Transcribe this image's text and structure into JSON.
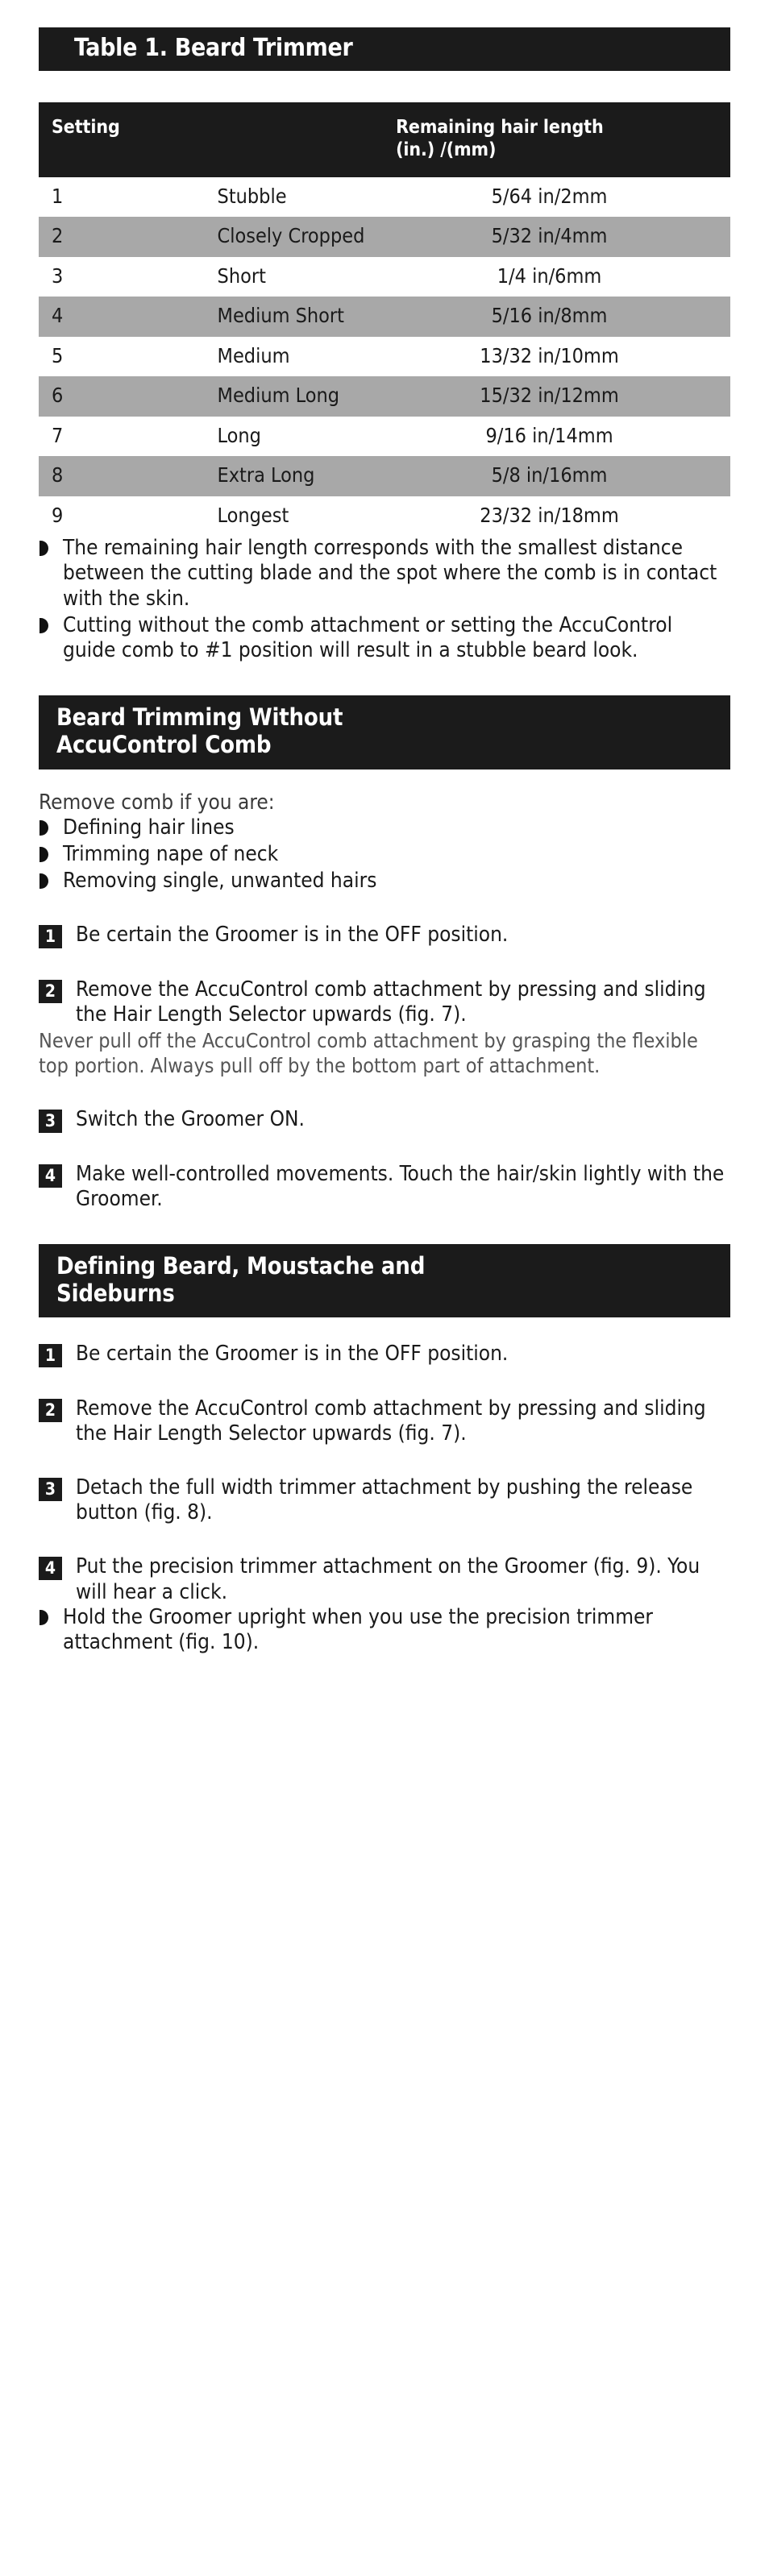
{
  "table_section": {
    "title": "Table 1. Beard Trimmer",
    "columns": [
      "Setting",
      "Remaining hair length (in.) /(mm)"
    ],
    "column_header_setting": "Setting",
    "column_header_length_line1": "Remaining hair length",
    "column_header_length_line2": "(in.) /(mm)",
    "rows": [
      {
        "setting": "1",
        "name": "Stubble",
        "length": "5/64 in/2mm"
      },
      {
        "setting": "2",
        "name": "Closely Cropped",
        "length": "5/32 in/4mm"
      },
      {
        "setting": "3",
        "name": "Short",
        "length": "1/4 in/6mm"
      },
      {
        "setting": "4",
        "name": "Medium Short",
        "length": "5/16 in/8mm"
      },
      {
        "setting": "5",
        "name": "Medium",
        "length": "13/32 in/10mm"
      },
      {
        "setting": "6",
        "name": "Medium Long",
        "length": "15/32 in/12mm"
      },
      {
        "setting": "7",
        "name": "Long",
        "length": "9/16 in/14mm"
      },
      {
        "setting": "8",
        "name": "Extra Long",
        "length": "5/8 in/16mm"
      },
      {
        "setting": "9",
        "name": "Longest",
        "length": "23/32 in/18mm"
      }
    ],
    "notes": [
      "The remaining hair length corresponds with the smallest distance between the cutting blade and the spot where the comb is in contact with the skin.",
      "Cutting without the comb attachment or setting the AccuControl guide comb to #1 position will result in a stubble beard look."
    ]
  },
  "section_without_comb": {
    "heading_line1": "Beard Trimming Without",
    "heading_line2": "AccuControl Comb",
    "lead": "Remove comb if you are:",
    "bullets": [
      "Defining hair lines",
      "Trimming nape of neck",
      "Removing single, unwanted hairs"
    ],
    "steps": [
      {
        "num": "1",
        "text": "Be certain the Groomer is in the OFF position."
      },
      {
        "num": "2",
        "text": "Remove the AccuControl comb attachment by pressing and sliding the Hair Length Selector upwards (fig. 7)."
      },
      {
        "num": "3",
        "text": "Switch the Groomer ON."
      },
      {
        "num": "4",
        "text": "Make well-controlled movements. Touch the hair/skin lightly with the Groomer."
      }
    ],
    "note_after_step2": "Never pull off the AccuControl comb attachment by grasping the flexible top portion. Always pull off by the bottom part of attachment."
  },
  "section_defining": {
    "heading_line1": "Defining Beard, Moustache and",
    "heading_line2": "Sideburns",
    "steps": [
      {
        "num": "1",
        "text": "Be certain the Groomer is in the OFF position."
      },
      {
        "num": "2",
        "text": "Remove the AccuControl comb attachment by pressing and sliding the Hair Length Selector upwards (fig. 7)."
      },
      {
        "num": "3",
        "text": "Detach the full width trimmer attachment by pushing the release button (fig. 8)."
      },
      {
        "num": "4",
        "text": "Put the precision trimmer attachment on the Groomer (fig. 9). You will hear a click."
      }
    ],
    "closing_bullets": [
      "Hold the Groomer upright when you use the precision trimmer attachment (fig. 10)."
    ]
  },
  "colors": {
    "bar_background": "#1b1b1b",
    "bar_text": "#ffffff",
    "row_alt_background": "#a8a8a8",
    "body_text": "#1a1a1a",
    "note_text": "#555555"
  }
}
